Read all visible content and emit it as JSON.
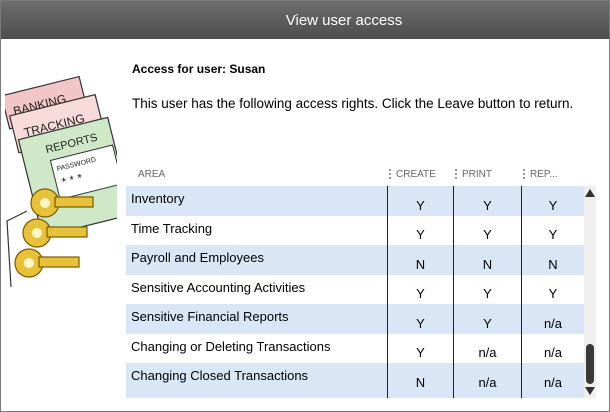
{
  "window": {
    "title": "View user access"
  },
  "illustration": {
    "icon": "accounting-folders-with-keys-icon",
    "labels": [
      "BANKING",
      "TRACKING",
      "REPORTS",
      "PASSWORD",
      "* * *"
    ]
  },
  "heading": "Access for user: Susan",
  "description": "This user has the following access rights.  Click the Leave button to return.",
  "table": {
    "columns": [
      "AREA",
      "CREATE",
      "PRINT",
      "REP..."
    ],
    "rows": [
      {
        "area": "Inventory",
        "create": "Y",
        "print": "Y",
        "rep": "Y"
      },
      {
        "area": "Time Tracking",
        "create": "Y",
        "print": "Y",
        "rep": "Y"
      },
      {
        "area": "Payroll and Employees",
        "create": "N",
        "print": "N",
        "rep": "N"
      },
      {
        "area": "Sensitive Accounting Activities",
        "create": "Y",
        "print": "Y",
        "rep": "Y"
      },
      {
        "area": "Sensitive Financial Reports",
        "create": "Y",
        "print": "Y",
        "rep": "n/a"
      },
      {
        "area": "Changing or Deleting Transactions",
        "create": "Y",
        "print": "n/a",
        "rep": "n/a"
      },
      {
        "area": "Changing Closed Transactions",
        "create": "N",
        "print": "n/a",
        "rep": "n/a"
      }
    ]
  },
  "colors": {
    "titlebar": "#5a5a5a",
    "row_alt": "#d9e6f5"
  }
}
